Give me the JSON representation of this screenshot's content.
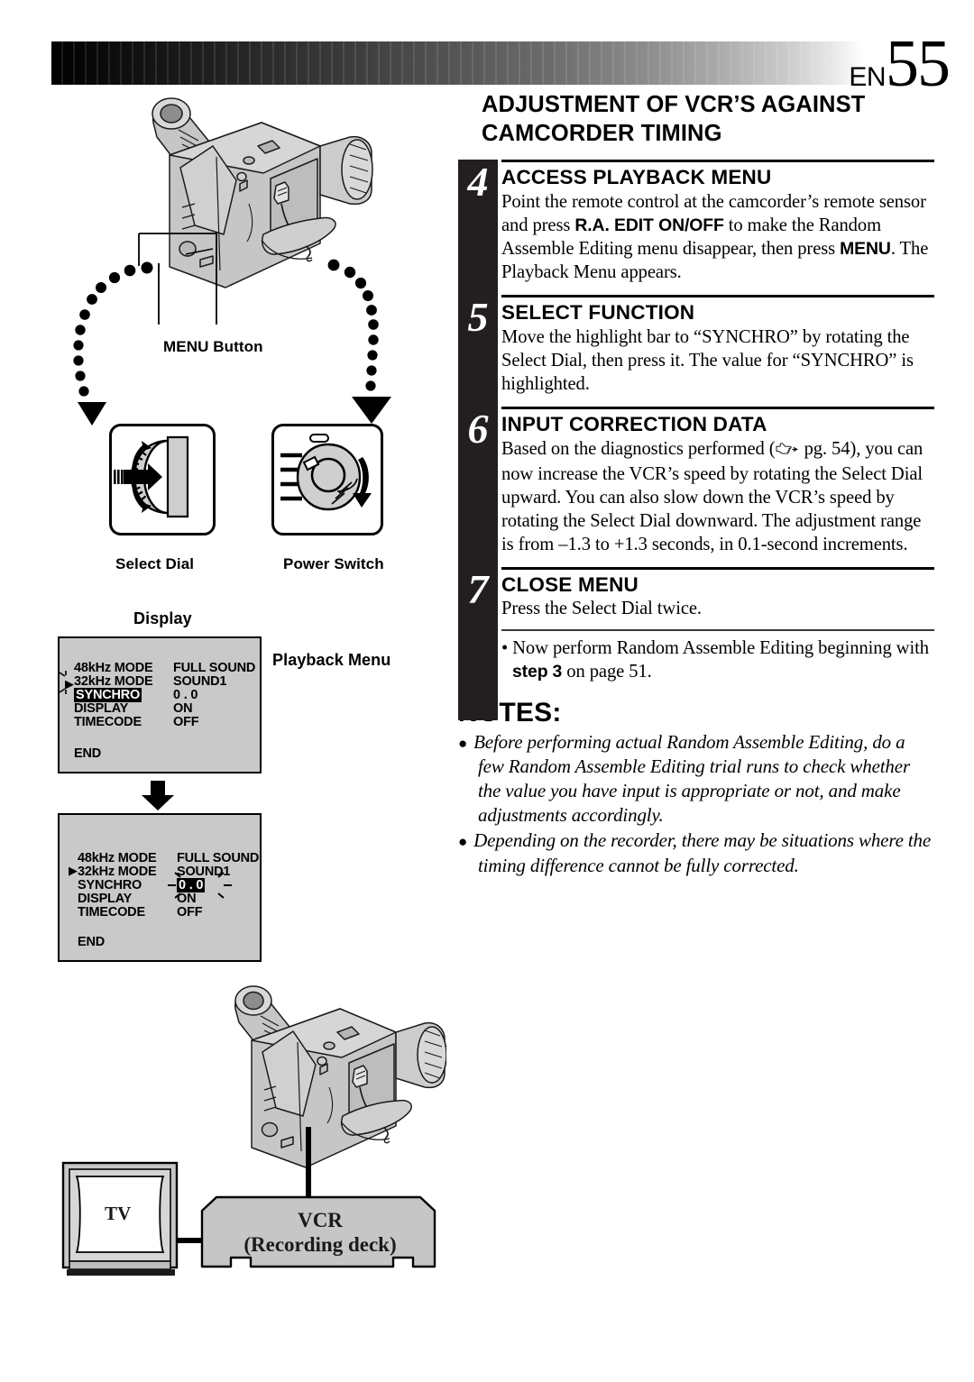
{
  "header": {
    "page_prefix": "EN",
    "page_number": "55"
  },
  "section": {
    "title": "ADJUSTMENT OF VCR’S AGAINST CAMCORDER TIMING"
  },
  "steps": [
    {
      "number": "4",
      "heading": "ACCESS PLAYBACK MENU",
      "body_1": "Point the remote control at the camcorder’s remote sensor and press ",
      "bold_1": "R.A. EDIT ON/OFF",
      "body_2": " to make the Random Assemble Editing menu disappear, then press ",
      "bold_2": "MENU",
      "body_3": ". The Playback Menu appears."
    },
    {
      "number": "5",
      "heading": "SELECT FUNCTION",
      "body_1": "Move the highlight bar to “SYNCHRO” by rotating the Select Dial, then press it. The value for “SYNCHRO” is highlighted."
    },
    {
      "number": "6",
      "heading": "INPUT CORRECTION DATA",
      "body_1": "Based on the diagnostics performed (",
      "ref_text": " pg. 54)",
      "body_2": ", you can now increase the VCR’s speed by rotating the Select Dial upward. You can also slow down the VCR’s speed by rotating the Select Dial downward. The adjustment range is from –1.3 to +1.3 seconds, in 0.1-second increments."
    },
    {
      "number": "7",
      "heading": "CLOSE MENU",
      "body_1": "Press the Select Dial twice."
    }
  ],
  "after_steps_bullet": {
    "text_1": "• Now perform Random Assemble Editing beginning with ",
    "bold_step": "step",
    "text_2": " ",
    "bold_num": "3",
    "text_3": " on page 51."
  },
  "notes": {
    "title": "NOTES:",
    "items": [
      "Before performing actual Random Assemble Editing, do a few Random Assemble Editing trial runs to check whether the value you have input is appropriate or not, and make adjustments accordingly.",
      "Depending on the recorder, there may be situations where the timing difference cannot be fully corrected."
    ]
  },
  "labels": {
    "menu_button": "MENU Button",
    "select_dial": "Select Dial",
    "power_switch": "Power Switch",
    "display": "Display",
    "playback_menu": "Playback Menu",
    "tv": "TV",
    "vcr_line1": "VCR",
    "vcr_line2": "(Recording deck)"
  },
  "osd_menu_1": {
    "cursor_symbol": "▶",
    "rows": [
      {
        "label": "48kHz  MODE",
        "value": "FULL SOUND",
        "label_highlight": false,
        "value_highlight": false
      },
      {
        "label": "32kHz  MODE",
        "value": "SOUND1",
        "label_highlight": false,
        "value_highlight": false
      },
      {
        "label": "SYNCHRO",
        "value": "0 . 0",
        "label_highlight": true,
        "value_highlight": false
      },
      {
        "label": "DISPLAY",
        "value": "ON",
        "label_highlight": false,
        "value_highlight": false
      },
      {
        "label": "TIMECODE",
        "value": "OFF",
        "label_highlight": false,
        "value_highlight": false
      }
    ],
    "end_label": "END"
  },
  "osd_menu_2": {
    "cursor_symbol": "▶",
    "rows": [
      {
        "label": "48kHz  MODE",
        "value": "FULL SOUND",
        "label_highlight": false,
        "value_highlight": false
      },
      {
        "label": "32kHz  MODE",
        "value": "SOUND1",
        "label_highlight": false,
        "value_highlight": false
      },
      {
        "label": "SYNCHRO",
        "value": "0 . 0",
        "label_highlight": false,
        "value_highlight": true
      },
      {
        "label": "DISPLAY",
        "value": "ON",
        "label_highlight": false,
        "value_highlight": false
      },
      {
        "label": "TIMECODE",
        "value": "OFF",
        "label_highlight": false,
        "value_highlight": false
      }
    ],
    "end_label": "END"
  },
  "colors": {
    "step_bar": "#231f20",
    "osd_background": "#c9c9c9",
    "device_fill": "#c6c6c6"
  }
}
